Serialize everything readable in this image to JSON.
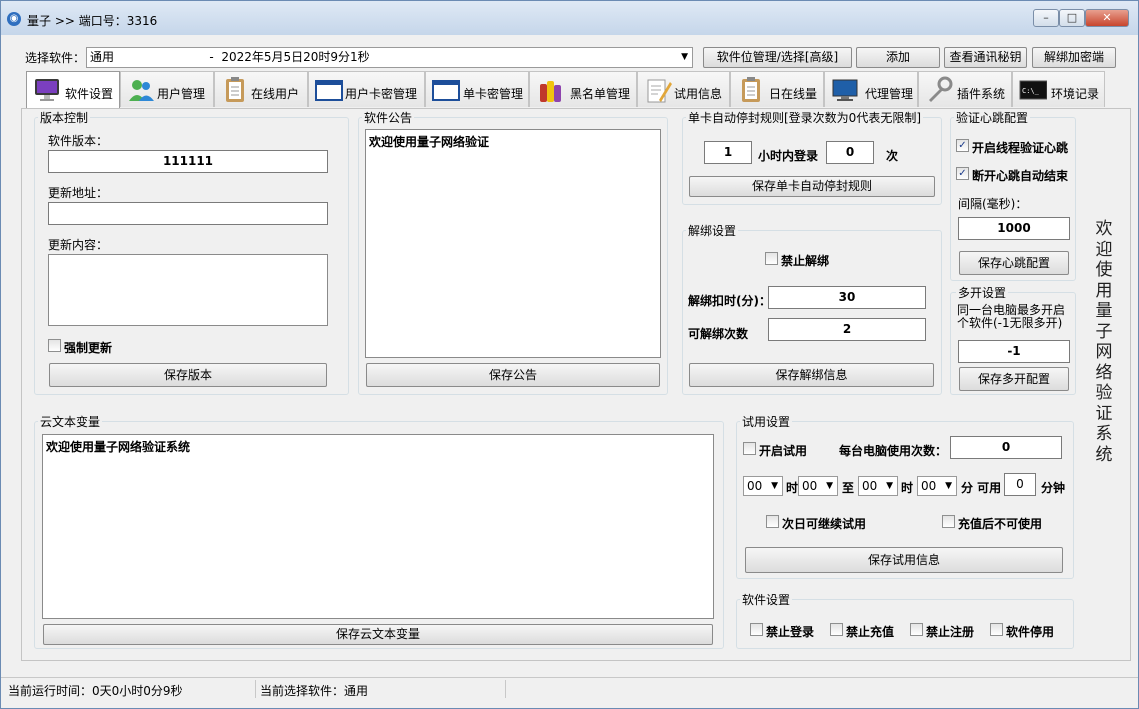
{
  "window": {
    "title": "量子 >> 端口号：3316",
    "minimize": "▭",
    "maximize": "□",
    "close": "✕"
  },
  "top": {
    "select_label": "选择软件：",
    "select_value": "通用                         -  2022年5月5日20时9分1秒",
    "buttons": [
      "软件位管理/选择[高级]",
      "添加",
      "查看通讯秘钥",
      "解绑加密端"
    ]
  },
  "tabs": [
    {
      "label": "软件设置",
      "icon": "imac-icon"
    },
    {
      "label": "用户管理",
      "icon": "users-icon"
    },
    {
      "label": "在线用户",
      "icon": "clipboard-icon"
    },
    {
      "label": "用户卡密管理",
      "icon": "window-icon"
    },
    {
      "label": "单卡密管理",
      "icon": "window-icon"
    },
    {
      "label": "黑名单管理",
      "icon": "bottles-icon"
    },
    {
      "label": "试用信息",
      "icon": "notepad-icon"
    },
    {
      "label": "日在线量",
      "icon": "clipboard-icon"
    },
    {
      "label": "代理管理",
      "icon": "monitor-icon"
    },
    {
      "label": "插件系统",
      "icon": "wrench-icon"
    },
    {
      "label": "环境记录",
      "icon": "terminal-icon"
    }
  ],
  "version": {
    "title": "版本控制",
    "version_label": "软件版本：",
    "version_value": "111111",
    "url_label": "更新地址：",
    "url_value": "",
    "content_label": "更新内容：",
    "content_value": "",
    "force_label": "强制更新",
    "save": "保存版本"
  },
  "notice": {
    "title": "软件公告",
    "content": "欢迎使用量子网络验证",
    "save": "保存公告"
  },
  "autoban": {
    "title": "单卡自动停封规则[登录次数为0代表无限制]",
    "hours": "1",
    "hours_label": "小时内登录",
    "count": "0",
    "count_label": "次",
    "save": "保存单卡自动停封规则"
  },
  "unbind": {
    "title": "解绑设置",
    "forbid_label": "禁止解绑",
    "deduct_label": "解绑扣时(分)：",
    "deduct_value": "30",
    "times_label": "可解绑次数",
    "times_value": "2",
    "save": "保存解绑信息"
  },
  "heartbeat": {
    "title": "验证心跳配置",
    "thread_label": "开启线程验证心跳",
    "disconnect_label": "断开心跳自动结束",
    "interval_label": "间隔(毫秒)：",
    "interval_value": "1000",
    "save": "保存心跳配置"
  },
  "multi": {
    "title": "多开设置",
    "desc1": "同一台电脑最多开启",
    "desc2": "个软件(-1无限多开)",
    "value": "-1",
    "save": "保存多开配置"
  },
  "cloud": {
    "title": "云文本变量",
    "content": "欢迎使用量子网络验证系统",
    "save": "保存云文本变量"
  },
  "trial": {
    "title": "试用设置",
    "enable_label": "开启试用",
    "per_pc_label": "每台电脑使用次数：",
    "per_pc_value": "0",
    "h1": "00",
    "hour_label1": "时",
    "m1": "00",
    "to_label": "至",
    "h2": "00",
    "hour_label2": "时",
    "m2": "00",
    "minute_label": "分 可用",
    "avail_value": "0",
    "avail_unit": "分钟",
    "nextday_label": "次日可继续试用",
    "after_recharge_label": "充值后不可使用",
    "save": "保存试用信息"
  },
  "software": {
    "title": "软件设置",
    "no_login": "禁止登录",
    "no_recharge": "禁止充值",
    "no_register": "禁止注册",
    "disable": "软件停用"
  },
  "side_text": "欢迎使用量子网络验证系统",
  "status": {
    "runtime": "当前运行时间：0天0小时0分9秒",
    "current": "当前选择软件：通用"
  }
}
